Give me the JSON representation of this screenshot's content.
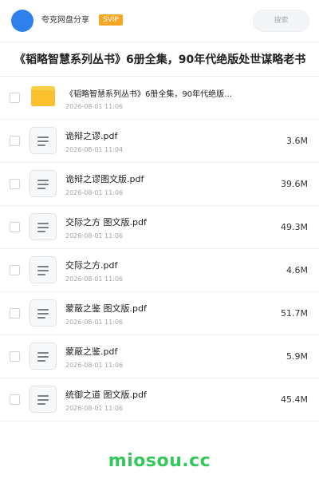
{
  "header": {
    "avatar_color": "#2f80ed",
    "app_name": "夸克网盘分享",
    "badge": "SVIP",
    "badge_color": "#f5a623",
    "search_placeholder": "搜索"
  },
  "title": "《韬略智慧系列丛书》6册全集，90年代绝版处世谋略老书",
  "files": [
    {
      "name": "《韬略智慧系列丛书》6册全集，90年代绝版…",
      "date": "2026-08-01 11:06",
      "size": "",
      "icon": "folder-icon"
    },
    {
      "name": "诡辩之谬.pdf",
      "date": "2026-08-01 11:04",
      "size": "3.6M",
      "icon": "document-icon"
    },
    {
      "name": "诡辩之谬图文版.pdf",
      "date": "2026-08-01 11:06",
      "size": "39.6M",
      "icon": "document-icon"
    },
    {
      "name": "交际之方 图文版.pdf",
      "date": "2026-08-01 11:06",
      "size": "49.3M",
      "icon": "document-icon"
    },
    {
      "name": "交际之方.pdf",
      "date": "2026-08-01 11:06",
      "size": "4.6M",
      "icon": "document-icon"
    },
    {
      "name": "蒙蔽之鉴 图文版.pdf",
      "date": "2026-08-01 11:06",
      "size": "51.7M",
      "icon": "document-icon"
    },
    {
      "name": "蒙蔽之鉴.pdf",
      "date": "2026-08-01 11:06",
      "size": "5.9M",
      "icon": "document-icon"
    },
    {
      "name": "统御之道 图文版.pdf",
      "date": "2026-08-01 11:06",
      "size": "45.4M",
      "icon": "document-icon"
    }
  ],
  "watermark": "miosou.cc",
  "watermark_color": "#34c759"
}
